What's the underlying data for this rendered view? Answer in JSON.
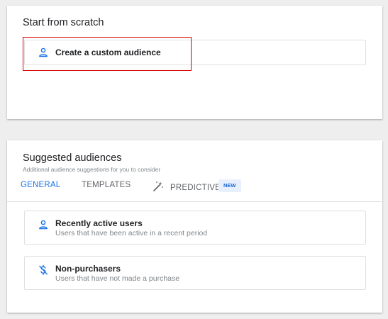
{
  "scratch": {
    "title": "Start from scratch",
    "custom_audience": {
      "label": "Create a custom audience",
      "icon": "person-icon"
    }
  },
  "suggested": {
    "title": "Suggested audiences",
    "subtitle": "Additional audience suggestions for you to consider",
    "tabs": [
      {
        "label": "GENERAL",
        "active": true
      },
      {
        "label": "TEMPLATES",
        "active": false
      },
      {
        "label": "PREDICTIVE",
        "active": false,
        "icon": "magic-wand-icon",
        "badge": "NEW"
      }
    ],
    "items": [
      {
        "title": "Recently active users",
        "description": "Users that have been active in a recent period",
        "icon": "person-icon"
      },
      {
        "title": "Non-purchasers",
        "description": "Users that have not made a purchase",
        "icon": "no-dollar-icon"
      }
    ]
  },
  "colors": {
    "accent": "#1a73e8",
    "highlight": "#d50000",
    "badge_bg": "#e8f0fe"
  }
}
